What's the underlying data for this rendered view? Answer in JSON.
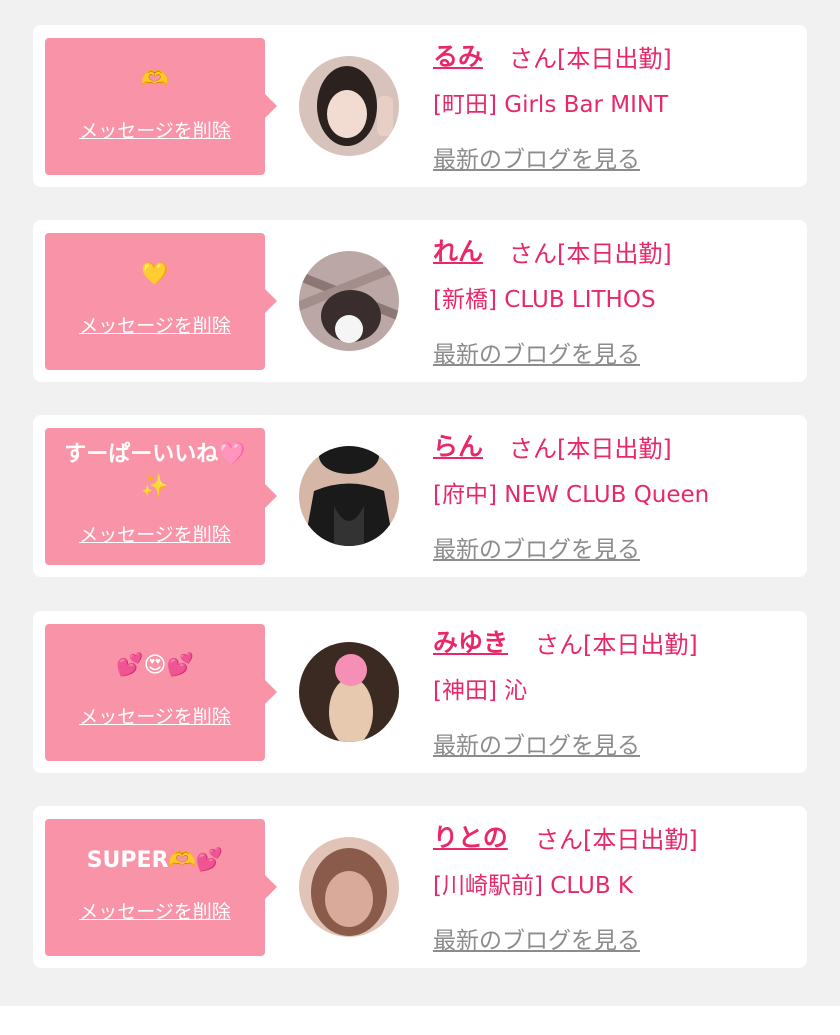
{
  "items": [
    {
      "message": "🫶",
      "delete_label": "メッセージを削除",
      "name": "るみ",
      "suffix": "さん[本日出勤]",
      "shop": "[町田] Girls Bar MINT",
      "blog_label": "最新のブログを見る",
      "avatar_icon": "profile-photo",
      "colors": {
        "bg": "#d7c3bc",
        "fg": "#2b2220"
      }
    },
    {
      "message": "💛",
      "delete_label": "メッセージを削除",
      "name": "れん",
      "suffix": "さん[本日出勤]",
      "shop": "[新橋] CLUB LITHOS",
      "blog_label": "最新のブログを見る",
      "avatar_icon": "profile-photo",
      "colors": {
        "bg": "#bba8a6",
        "fg": "#3a2d2d"
      }
    },
    {
      "message": "すーぱーいいね🩷\n✨",
      "delete_label": "メッセージを削除",
      "name": "らん",
      "suffix": "さん[本日出勤]",
      "shop": "[府中] NEW CLUB Queen",
      "blog_label": "最新のブログを見る",
      "avatar_icon": "profile-photo",
      "colors": {
        "bg": "#d5b6a7",
        "fg": "#1a1a1a"
      }
    },
    {
      "message": "💕😍💕",
      "delete_label": "メッセージを削除",
      "name": "みゆき",
      "suffix": "さん[本日出勤]",
      "shop": "[神田] 沁",
      "blog_label": "最新のブログを見る",
      "avatar_icon": "profile-photo",
      "colors": {
        "bg": "#3b2a22",
        "fg": "#e7c9b0"
      }
    },
    {
      "message": "SUPER🫶💕",
      "delete_label": "メッセージを削除",
      "name": "りとの",
      "suffix": "さん[本日出勤]",
      "shop": "[川崎駅前] CLUB K",
      "blog_label": "最新のブログを見る",
      "avatar_icon": "profile-photo",
      "colors": {
        "bg": "#e2c3b8",
        "fg": "#8a5a4b"
      }
    }
  ],
  "theme": {
    "accent": "#e8286a",
    "bubble": "#f993a8",
    "muted": "#8c8c8c"
  }
}
